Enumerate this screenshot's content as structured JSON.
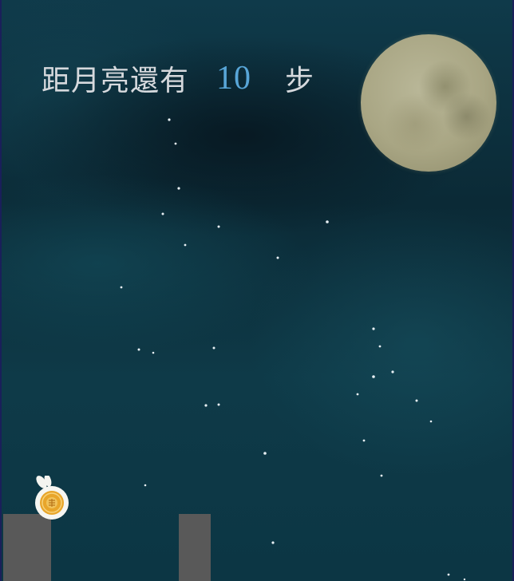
{
  "hud": {
    "prefix": "距月亮還有",
    "steps_remaining": "10",
    "suffix": "步"
  },
  "colors": {
    "sky": "#0b2a36",
    "counter": "#58a6d8",
    "text": "#d6d9dd",
    "moon": "#a9a684",
    "pillar": "#595959"
  },
  "icons": {
    "player": "mooncake-rabbit-icon",
    "moon": "moon-icon"
  }
}
